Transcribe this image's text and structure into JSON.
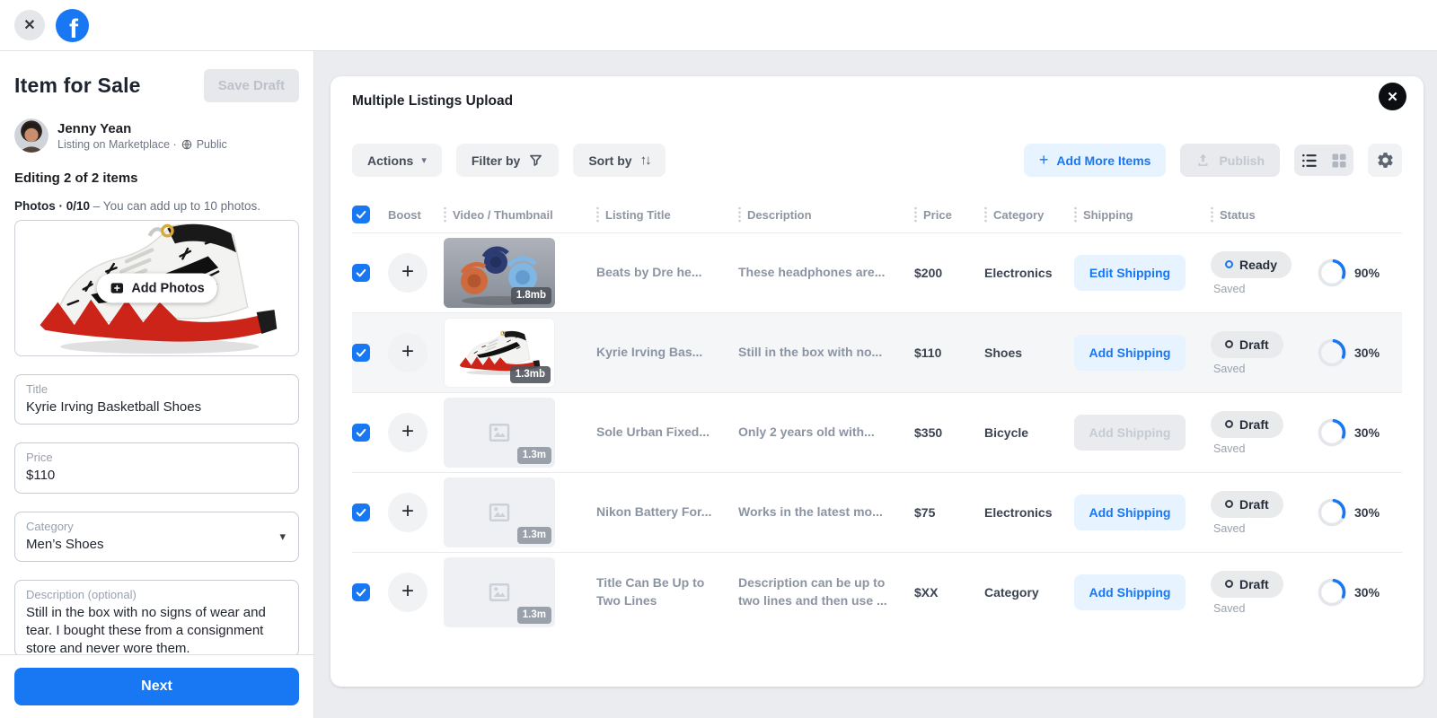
{
  "icons": {
    "close": "✕",
    "plus": "+",
    "caret_down": "▾",
    "sort_arrows": "↑↓",
    "logo_letter": "f"
  },
  "colors": {
    "accent_blue": "#1877f2",
    "light_blue_bg": "#e7f3ff",
    "page_bg": "#eaecef"
  },
  "left_panel": {
    "title": "Item for Sale",
    "save_draft_label": "Save Draft",
    "profile": {
      "name": "Jenny Yean",
      "context": "Listing on Marketplace ·",
      "privacy": "Public"
    },
    "editing_status": "Editing 2 of 2 items",
    "photos": {
      "count_label": "Photos · 0/10",
      "hint": "– You can add up to 10 photos.",
      "add_button": "Add Photos"
    },
    "fields": {
      "title": {
        "label": "Title",
        "value": "Kyrie Irving Basketball Shoes"
      },
      "price": {
        "label": "Price",
        "value": "$110"
      },
      "category": {
        "label": "Category",
        "value": "Men’s Shoes"
      },
      "description": {
        "label": "Description (optional)",
        "value": "Still in the box with no signs of wear and tear. I bought these from a consignment store and never wore them."
      }
    },
    "next_button": "Next"
  },
  "modal": {
    "title": "Multiple Listings Upload",
    "toolbar": {
      "actions": "Actions",
      "filter": "Filter by",
      "sort": "Sort by",
      "add_more": "Add More Items",
      "publish": "Publish"
    },
    "columns": {
      "boost": "Boost",
      "thumbnail": "Video / Thumbnail",
      "title": "Listing Title",
      "description": "Description",
      "price": "Price",
      "category": "Category",
      "shipping": "Shipping",
      "status": "Status"
    },
    "rows": [
      {
        "selected": true,
        "thumb": "headphones",
        "size_badge": "1.8mb",
        "title": "Beats by Dre he...",
        "description": "These headphones are...",
        "price": "$200",
        "category": "Electronics",
        "shipping_label": "Edit Shipping",
        "shipping_enabled": true,
        "status_label": "Ready",
        "status_dot": "blue",
        "saved_label": "Saved",
        "progress": "90%"
      },
      {
        "selected": true,
        "highlighted": true,
        "thumb": "sneaker",
        "size_badge": "1.3mb",
        "title": "Kyrie Irving Bas...",
        "description": "Still in the box with no...",
        "price": "$110",
        "category": "Shoes",
        "shipping_label": "Add Shipping",
        "shipping_enabled": true,
        "status_label": "Draft",
        "status_dot": "dark",
        "saved_label": "Saved",
        "progress": "30%"
      },
      {
        "selected": true,
        "thumb": "placeholder",
        "size_badge": "1.3m",
        "title": "Sole Urban Fixed...",
        "description": "Only 2 years old with...",
        "price": "$350",
        "category": "Bicycle",
        "shipping_label": "Add Shipping",
        "shipping_enabled": false,
        "status_label": "Draft",
        "status_dot": "dark",
        "saved_label": "Saved",
        "progress": "30%"
      },
      {
        "selected": true,
        "thumb": "placeholder",
        "size_badge": "1.3m",
        "title": "Nikon Battery For...",
        "description": "Works in the latest mo...",
        "price": "$75",
        "category": "Electronics",
        "shipping_label": "Add Shipping",
        "shipping_enabled": true,
        "status_label": "Draft",
        "status_dot": "dark",
        "saved_label": "Saved",
        "progress": "30%"
      },
      {
        "selected": true,
        "thumb": "placeholder",
        "size_badge": "1.3m",
        "title": "Title Can Be Up to Two Lines",
        "description": "Description can be up to two lines and then use ...",
        "price": "$XX",
        "category": "Category",
        "shipping_label": "Add Shipping",
        "shipping_enabled": true,
        "status_label": "Draft",
        "status_dot": "dark",
        "saved_label": "Saved",
        "progress": "30%"
      }
    ]
  }
}
